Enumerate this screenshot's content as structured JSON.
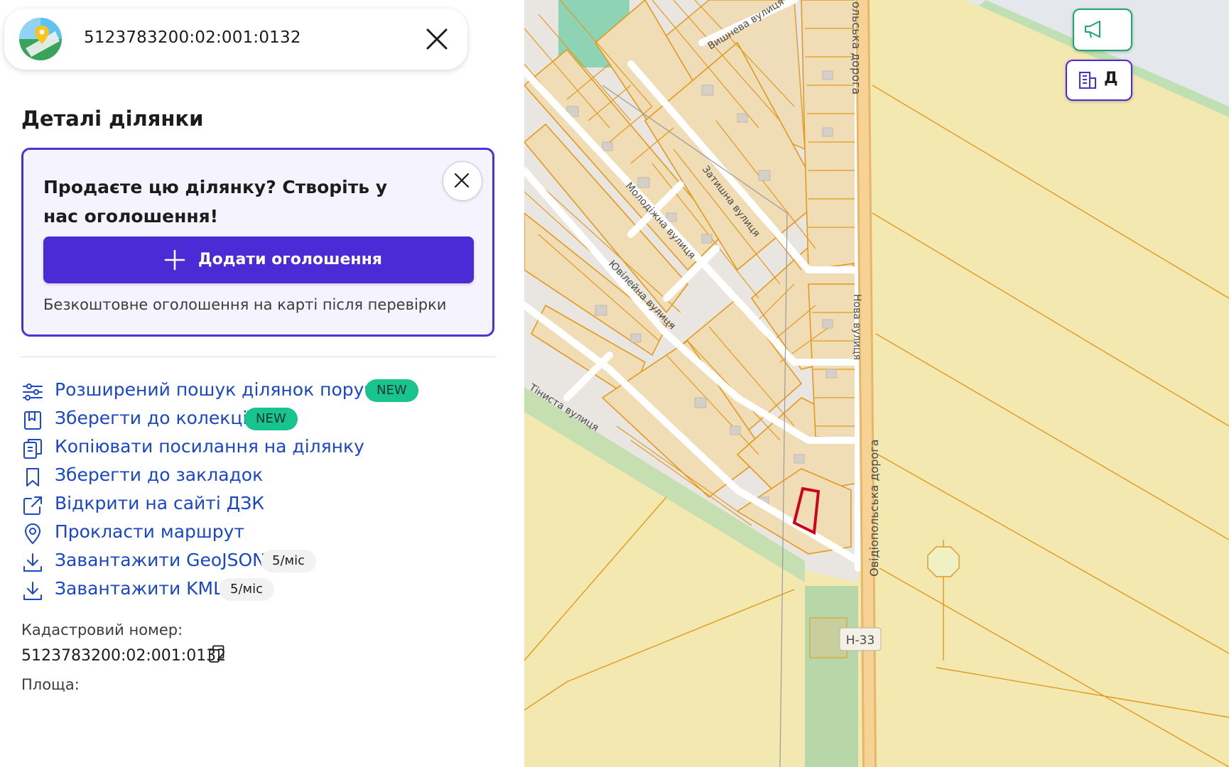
{
  "search": {
    "value": "5123783200:02:001:0132"
  },
  "panel": {
    "title": "Деталі ділянки",
    "promo": {
      "title": "Продаєте цю ділянку? Створіть у нас оголошення!",
      "button_label": "Додати оголошення",
      "note": "Безкоштовне оголошення на карті після перевірки"
    },
    "actions": [
      {
        "label": "Розширений пошук ділянок поруч",
        "badge": "NEW",
        "icon": "sliders-icon"
      },
      {
        "label": "Зберегти до колекції",
        "badge": "NEW",
        "icon": "collection-icon"
      },
      {
        "label": "Копіювати посилання на ділянку",
        "icon": "copy-link-icon"
      },
      {
        "label": "Зберегти до закладок",
        "icon": "bookmark-icon"
      },
      {
        "label": "Відкрити на сайті ДЗК",
        "icon": "external-link-icon"
      },
      {
        "label": "Прокласти маршрут",
        "icon": "location-pin-icon"
      },
      {
        "label": "Завантажити GeoJSON",
        "badge": "5/міс",
        "icon": "download-icon"
      },
      {
        "label": "Завантажити KML",
        "badge": "5/міс",
        "icon": "download-icon"
      }
    ],
    "info": {
      "cadastral_label": "Кадастровий номер:",
      "cadastral_value": "5123783200:02:001:0132",
      "area_label": "Площа:"
    }
  },
  "map": {
    "streets": [
      "Вишнева вулиця",
      "Затишна вулиця",
      "Молодіжна вулиця",
      "Ювілейна вулиця",
      "Тіниста вулиця",
      "Нова вулиця",
      "Овідіопольська дорога",
      "ольська дорога"
    ],
    "road_badge": "Н-33",
    "top_right_label": "Д"
  },
  "colors": {
    "accent": "#4b2bd6",
    "link": "#1a47c8",
    "badge_new": "#19c38e",
    "parcel_fill": "#f0ddb5",
    "parcel_stroke": "#e39a1a",
    "selected_parcel": "#d0021b",
    "field": "#f2e8b0"
  }
}
